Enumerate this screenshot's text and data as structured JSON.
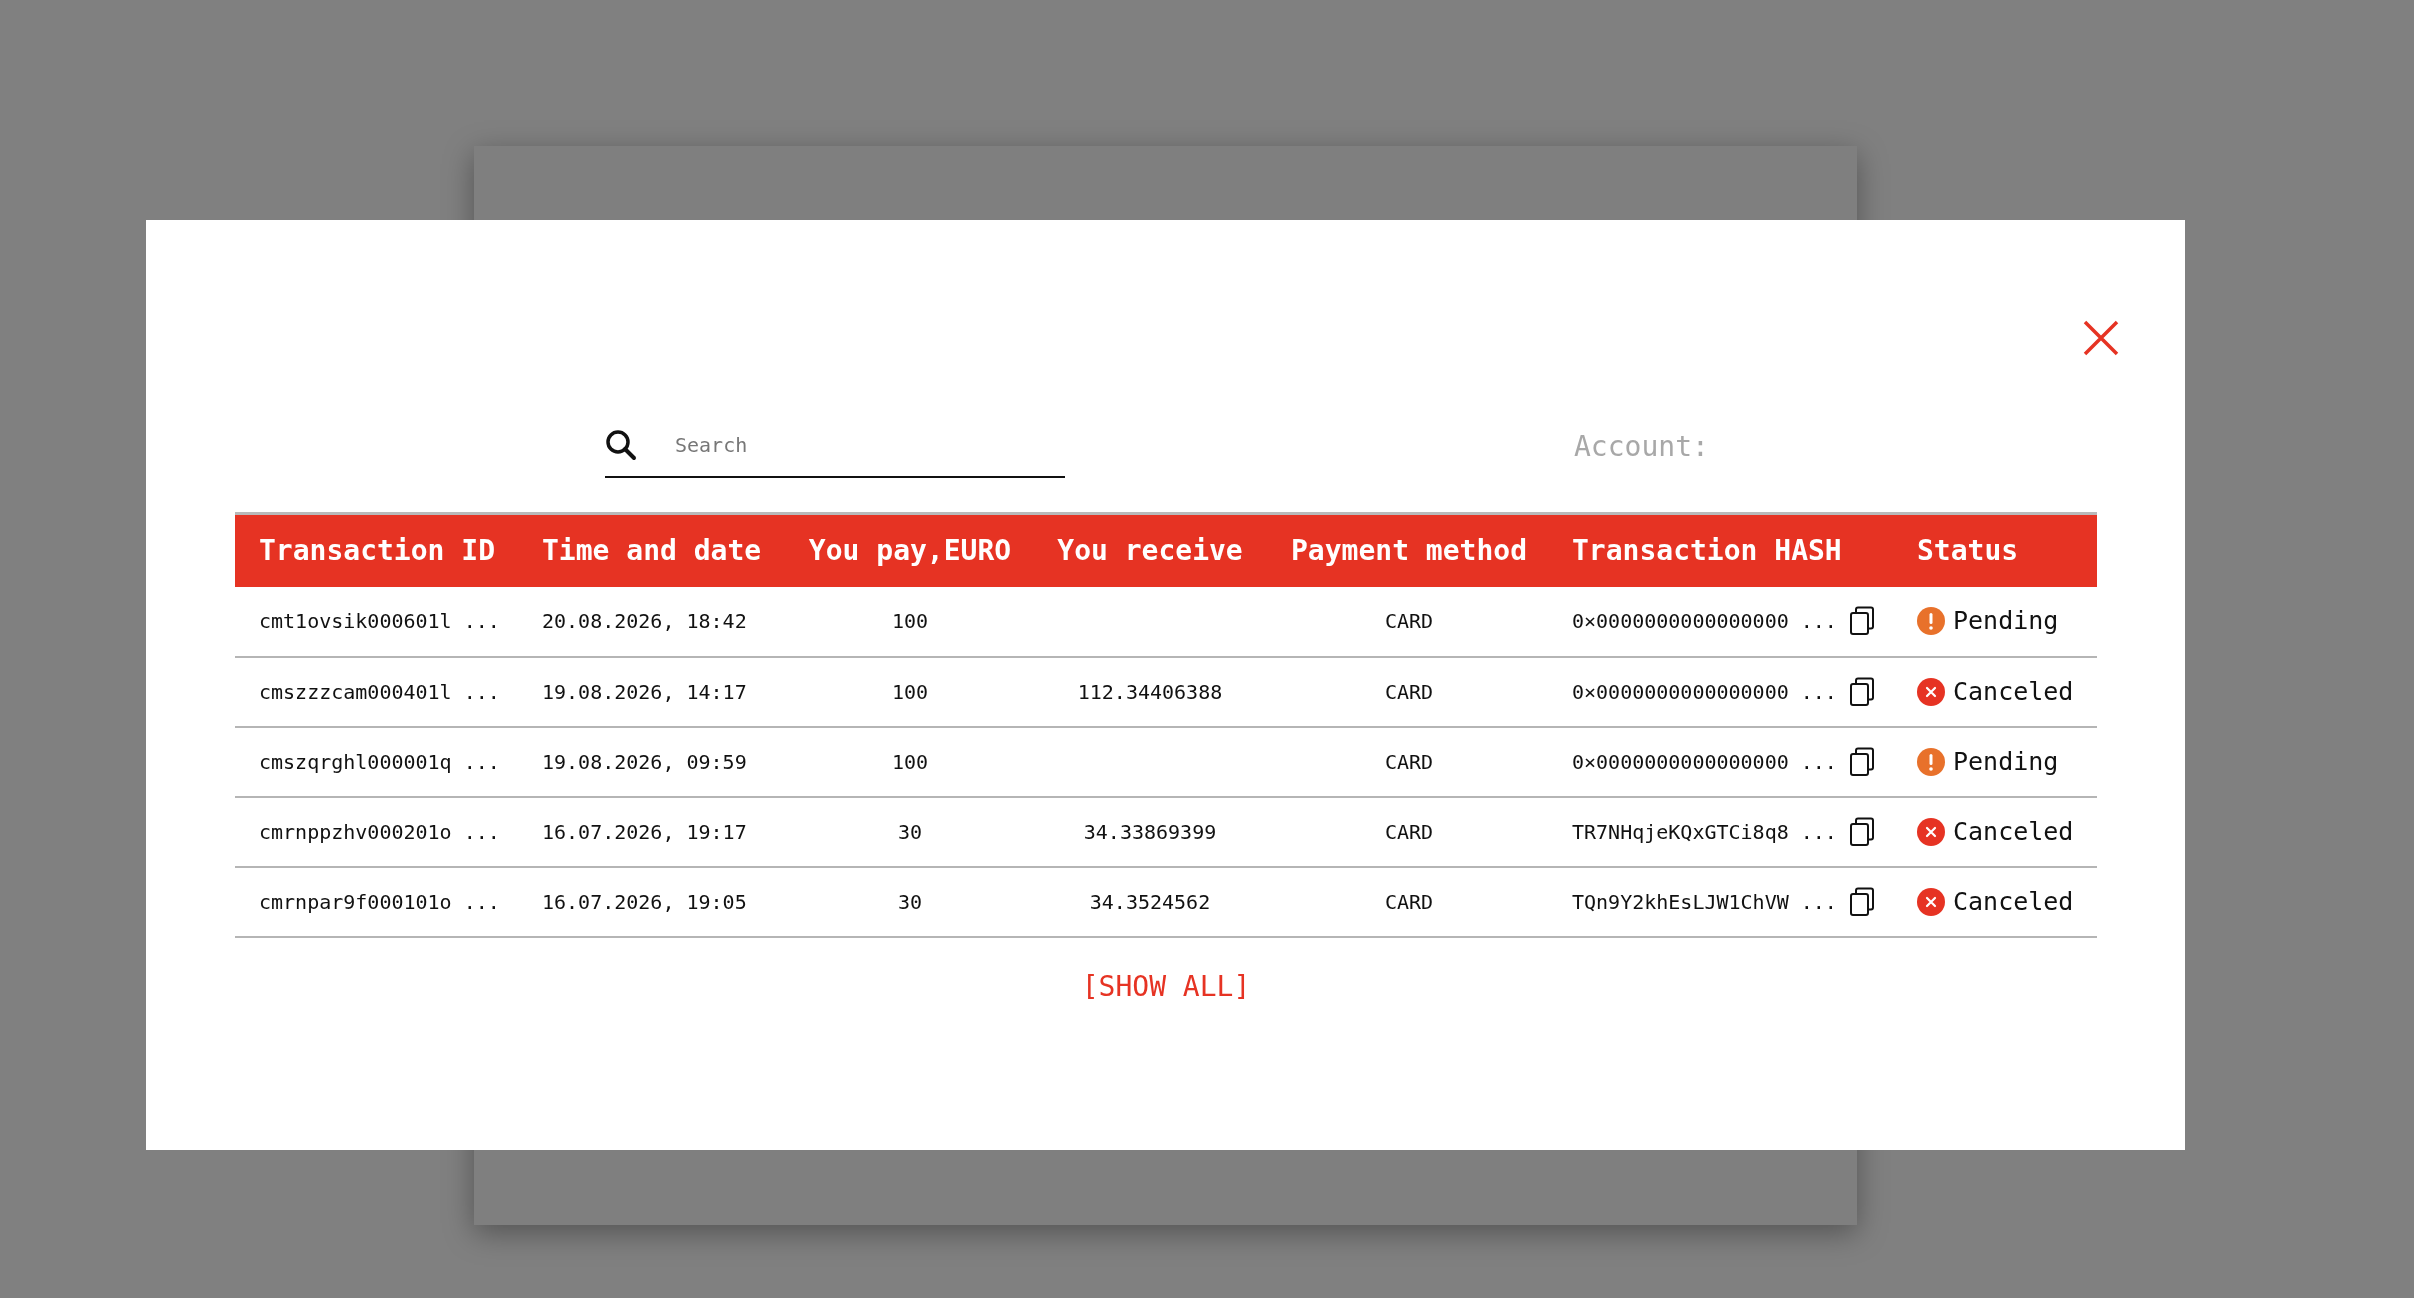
{
  "modal": {
    "search": {
      "placeholder": "Search"
    },
    "account_label": "Account:",
    "table": {
      "columns": [
        "Transaction ID",
        "Time and date",
        "You pay,EURO",
        "You receive",
        "Payment method",
        "Transaction HASH",
        "Status"
      ],
      "rows": [
        {
          "id": "cmt1ovsik000601l ...",
          "time": "20.08.2026, 18:42",
          "pay": "100",
          "receive": "",
          "method": "CARD",
          "hash": "0×0000000000000000 ...",
          "status": {
            "kind": "pending",
            "label": "Pending"
          }
        },
        {
          "id": "cmszzzcam000401l ...",
          "time": "19.08.2026, 14:17",
          "pay": "100",
          "receive": "112.34406388",
          "method": "CARD",
          "hash": "0×0000000000000000 ...",
          "status": {
            "kind": "canceled",
            "label": "Canceled"
          }
        },
        {
          "id": "cmszqrghl000001q ...",
          "time": "19.08.2026, 09:59",
          "pay": "100",
          "receive": "",
          "method": "CARD",
          "hash": "0×0000000000000000 ...",
          "status": {
            "kind": "pending",
            "label": "Pending"
          }
        },
        {
          "id": "cmrnppzhv000201o ...",
          "time": "16.07.2026, 19:17",
          "pay": "30",
          "receive": "34.33869399",
          "method": "CARD",
          "hash": "TR7NHqjeKQxGTCi8q8 ...",
          "status": {
            "kind": "canceled",
            "label": "Canceled"
          }
        },
        {
          "id": "cmrnpar9f000101o ...",
          "time": "16.07.2026, 19:05",
          "pay": "30",
          "receive": "34.3524562",
          "method": "CARD",
          "hash": "TQn9Y2khEsLJW1ChVW ...",
          "status": {
            "kind": "canceled",
            "label": "Canceled"
          }
        }
      ]
    },
    "show_all": "[SHOW ALL]"
  }
}
